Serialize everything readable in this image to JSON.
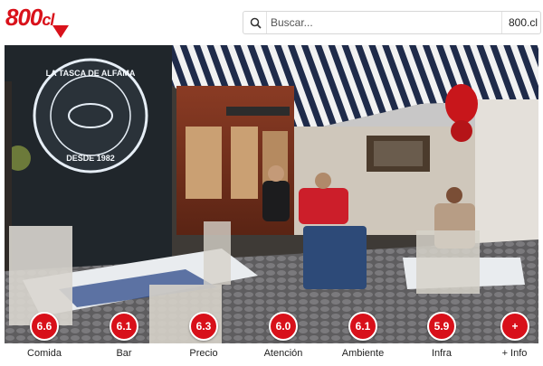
{
  "header": {
    "logo_text": "800",
    "logo_suffix": "cl",
    "search_placeholder": "Buscar...",
    "site_label": "800.cl"
  },
  "photo": {
    "sign_line1": "LA TASCA DE ALFAMA",
    "sign_line2": "DESDE 1982"
  },
  "scores": [
    {
      "value": "6.6",
      "label": "Comida"
    },
    {
      "value": "6.1",
      "label": "Bar"
    },
    {
      "value": "6.3",
      "label": "Precio"
    },
    {
      "value": "6.0",
      "label": "Atención"
    },
    {
      "value": "6.1",
      "label": "Ambiente"
    },
    {
      "value": "5.9",
      "label": "Infra"
    },
    {
      "value": "+",
      "label": "+ Info"
    }
  ],
  "colors": {
    "brand_red": "#d8101a",
    "awning_blue": "#1f2b4a"
  }
}
